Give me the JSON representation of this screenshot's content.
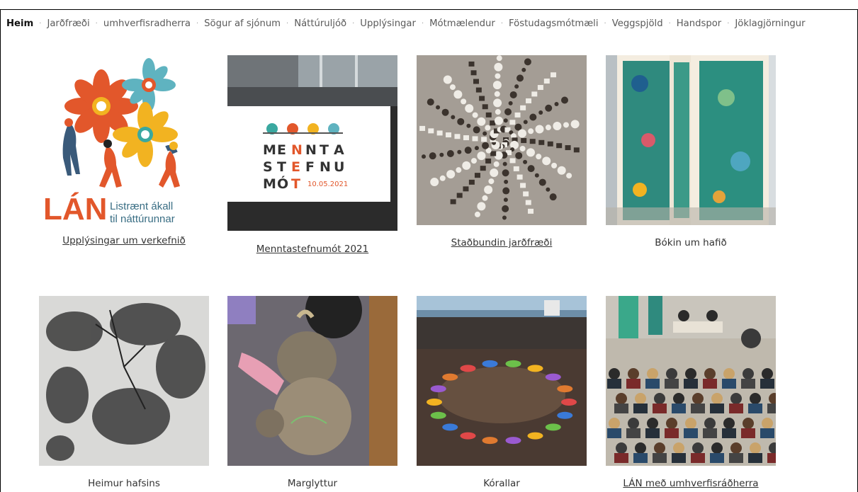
{
  "nav": {
    "items": [
      {
        "label": "Heim",
        "active": true
      },
      {
        "label": "Jarðfræði"
      },
      {
        "label": "umhverfisradherra"
      },
      {
        "label": "Sögur af sjónum"
      },
      {
        "label": "Náttúruljóð"
      },
      {
        "label": "Upplýsingar"
      },
      {
        "label": "Mótmælendur"
      },
      {
        "label": "Föstudagsmótmæli"
      },
      {
        "label": "Veggspjöld"
      },
      {
        "label": "Handspor"
      },
      {
        "label": "Jöklagjörningur"
      }
    ],
    "separator": "·"
  },
  "logo": {
    "wordmark": "LÁN",
    "tagline1": "Listrænt ákall",
    "tagline2": "til náttúrunnar"
  },
  "menntastefnumot": {
    "line1": [
      "M",
      "E",
      "N",
      "N",
      "T",
      "A"
    ],
    "line2": [
      "S",
      "T",
      "E",
      "F",
      "N",
      "U"
    ],
    "line3": [
      "M",
      "Ó",
      "T"
    ],
    "date": "10.05.2021"
  },
  "tiles": [
    {
      "caption": "Upplýsingar um verkefnið",
      "link": true
    },
    {
      "caption": "Menntastefnumót 2021",
      "link": true
    },
    {
      "caption": "Staðbundin jarðfræði",
      "link": true
    },
    {
      "caption": "Bókin um hafið",
      "link": false
    },
    {
      "caption": "Heimur hafsins",
      "link": false
    },
    {
      "caption": "Marglyttur",
      "link": false
    },
    {
      "caption": "Kórallar",
      "link": false
    },
    {
      "caption": "LÁN með umhverfisráðherra",
      "link": true
    }
  ],
  "colors": {
    "orange": "#e2572b",
    "teal": "#3aa8a0",
    "yellow": "#f2b321",
    "nav_text": "#5a5a5a"
  }
}
